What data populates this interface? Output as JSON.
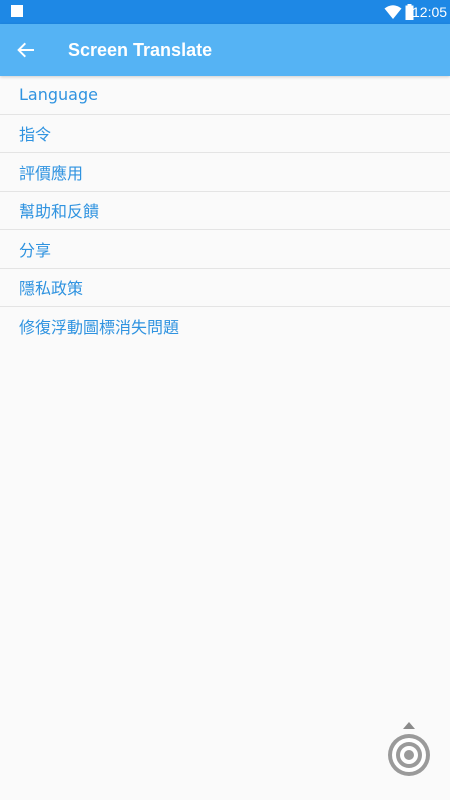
{
  "status_bar": {
    "time": "12:05",
    "icons": [
      "notification-square-icon",
      "wifi-icon",
      "battery-icon"
    ],
    "background": "#1e88e5"
  },
  "app_bar": {
    "title": "Screen Translate",
    "back_icon": "arrow-back-icon",
    "background": "#55b3f4"
  },
  "menu": {
    "items": [
      {
        "label": "Language"
      },
      {
        "label": "指令"
      },
      {
        "label": "評價應用"
      },
      {
        "label": "幫助和反饋"
      },
      {
        "label": "分享"
      },
      {
        "label": "隱私政策"
      },
      {
        "label": "修復浮動圖標消失問題"
      }
    ],
    "text_color": "#2f93e0"
  },
  "floating_widget": {
    "icon": "target-rings-icon"
  }
}
